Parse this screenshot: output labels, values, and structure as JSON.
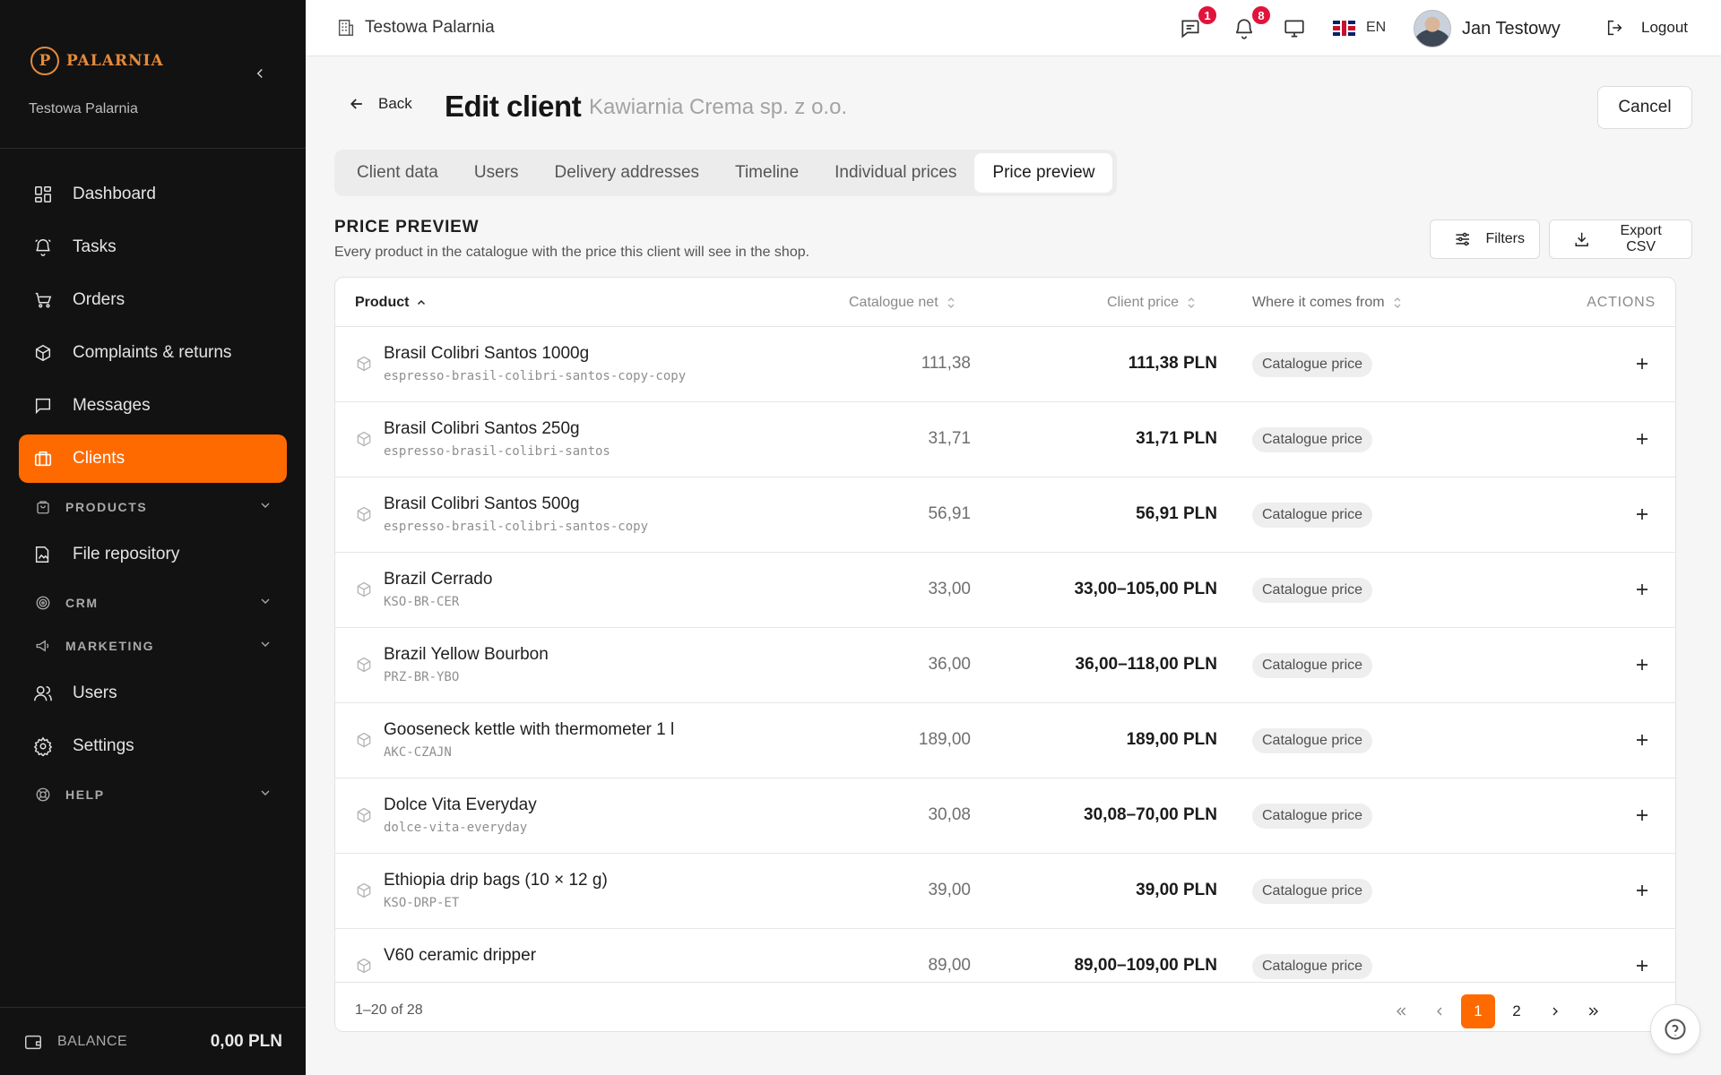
{
  "brand": {
    "logo_text": "PALARNIA",
    "logo_mark": "P",
    "org": "Testowa Palarnia"
  },
  "nav": {
    "dashboard": "Dashboard",
    "tasks": "Tasks",
    "orders": "Orders",
    "complaints": "Complaints & returns",
    "messages": "Messages",
    "clients": "Clients",
    "products": "PRODUCTS",
    "files": "File repository",
    "crm": "CRM",
    "marketing": "MARKETING",
    "users": "Users",
    "settings": "Settings",
    "help": "HELP"
  },
  "balance": {
    "label": "BALANCE",
    "value": "0,00 PLN"
  },
  "topbar": {
    "org": "Testowa Palarnia",
    "messages_count": "1",
    "notifications_count": "8",
    "lang": "EN",
    "user_name": "Jan Testowy",
    "logout": "Logout"
  },
  "header": {
    "back": "Back",
    "title": "Edit client",
    "subtitle": "Kawiarnia Crema sp. z o.o.",
    "cancel": "Cancel"
  },
  "tabs": [
    "Client data",
    "Users",
    "Delivery addresses",
    "Timeline",
    "Individual prices",
    "Price preview"
  ],
  "section": {
    "title": "PRICE PREVIEW",
    "description": "Every product in the catalogue with the price this client will see in the shop.",
    "filters": "Filters",
    "export": "Export CSV"
  },
  "table": {
    "columns": {
      "product": "Product",
      "net": "Catalogue net",
      "client_price": "Client price",
      "source": "Where it comes from",
      "actions": "ACTIONS"
    },
    "rows": [
      {
        "name": "Brasil Colibri Santos 1000g",
        "sku": "espresso-brasil-colibri-santos-copy-copy",
        "net": "111,38",
        "price": "111,38 PLN",
        "source": "Catalogue price"
      },
      {
        "name": "Brasil Colibri Santos 250g",
        "sku": "espresso-brasil-colibri-santos",
        "net": "31,71",
        "price": "31,71 PLN",
        "source": "Catalogue price"
      },
      {
        "name": "Brasil Colibri Santos 500g",
        "sku": "espresso-brasil-colibri-santos-copy",
        "net": "56,91",
        "price": "56,91 PLN",
        "source": "Catalogue price"
      },
      {
        "name": "Brazil Cerrado",
        "sku": "KSO-BR-CER",
        "net": "33,00",
        "price": "33,00–105,00 PLN",
        "source": "Catalogue price"
      },
      {
        "name": "Brazil Yellow Bourbon",
        "sku": "PRZ-BR-YBO",
        "net": "36,00",
        "price": "36,00–118,00 PLN",
        "source": "Catalogue price"
      },
      {
        "name": "Gooseneck kettle with thermometer 1 l",
        "sku": "AKC-CZAJN",
        "net": "189,00",
        "price": "189,00 PLN",
        "source": "Catalogue price"
      },
      {
        "name": "Dolce Vita Everyday",
        "sku": "dolce-vita-everyday",
        "net": "30,08",
        "price": "30,08–70,00 PLN",
        "source": "Catalogue price"
      },
      {
        "name": "Ethiopia drip bags (10 × 12 g)",
        "sku": "KSO-DRP-ET",
        "net": "39,00",
        "price": "39,00 PLN",
        "source": "Catalogue price"
      },
      {
        "name": "V60 ceramic dripper",
        "sku": "",
        "net": "89,00",
        "price": "89,00–109,00 PLN",
        "source": "Catalogue price"
      }
    ]
  },
  "pagination": {
    "range": "1–20 of 28",
    "pages": [
      "1",
      "2"
    ],
    "current": "1"
  },
  "colors": {
    "accent": "#ff6a00",
    "sidebar_bg": "#121212",
    "badge": "#e0143c",
    "logo": "#e58a3a"
  }
}
